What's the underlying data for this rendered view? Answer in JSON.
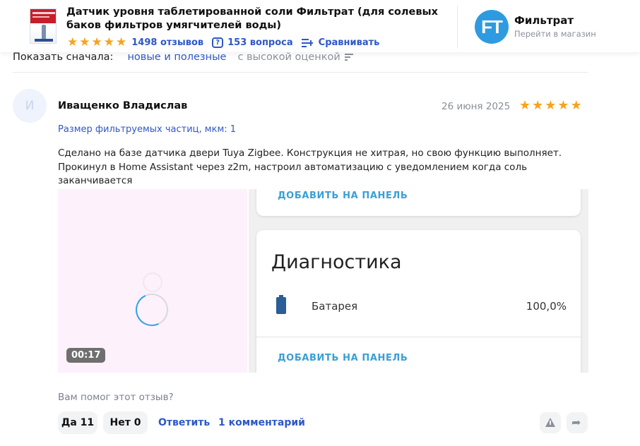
{
  "product": {
    "title": "Датчик уровня таблетированной соли Фильтрат (для солевых баков фильтров умягчителей воды)",
    "rating_stars": 5,
    "reviews_label": "1498 отзывов",
    "questions_label": "153 вопроса",
    "compare_label": "Сравнивать"
  },
  "shop": {
    "logo_text": "FT",
    "name": "Фильтрат",
    "link_label": "Перейти в магазин"
  },
  "sort": {
    "label": "Показать сначала:",
    "option_new": "новые и полезные",
    "option_high": "с высокой оценкой"
  },
  "review": {
    "avatar_letter": "И",
    "author": "Иващенко Владислав",
    "date": "26 июня 2025",
    "rating_stars": 5,
    "param": "Размер фильтруемых частиц, мкм: 1",
    "text": "Сделано на базе датчика двери Tuya Zigbee. Конструкция не хитрая, но свою функцию выполняет. Прокинул в Home Assistant через z2m, настроил автоматизацию с уведомлением когда соль заканчивается",
    "video_duration": "00:17",
    "screenshot": {
      "add_to_panel": "ДОБАВИТЬ НА ПАНЕЛЬ",
      "section_title": "Диагностика",
      "battery_label": "Батарея",
      "battery_value": "100,0%"
    }
  },
  "helpful": {
    "question": "Вам помог этот отзыв?",
    "yes_label": "Да 11",
    "no_label": "Нет 0",
    "reply_label": "Ответить",
    "comments_label": "1 комментарий"
  },
  "colors": {
    "accent": "#2e58c7",
    "star": "#f7a31c",
    "shop_logo": "#2e9be0"
  }
}
